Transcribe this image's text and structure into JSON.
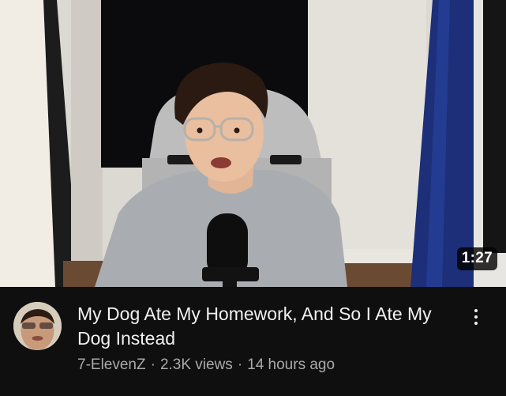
{
  "video": {
    "duration": "1:27",
    "title": "My Dog Ate My Homework, And So I Ate My Dog Instead",
    "channel": "7-ElevenZ",
    "separator": "·",
    "views": "2.3K views",
    "age": "14 hours ago"
  },
  "icons": {
    "more": "more-vert-icon",
    "avatar": "channel-avatar"
  },
  "colors": {
    "background": "#0f0f0f",
    "title": "#f1f1f1",
    "secondary_text": "#aaaaaa",
    "duration_badge": "#000000"
  }
}
